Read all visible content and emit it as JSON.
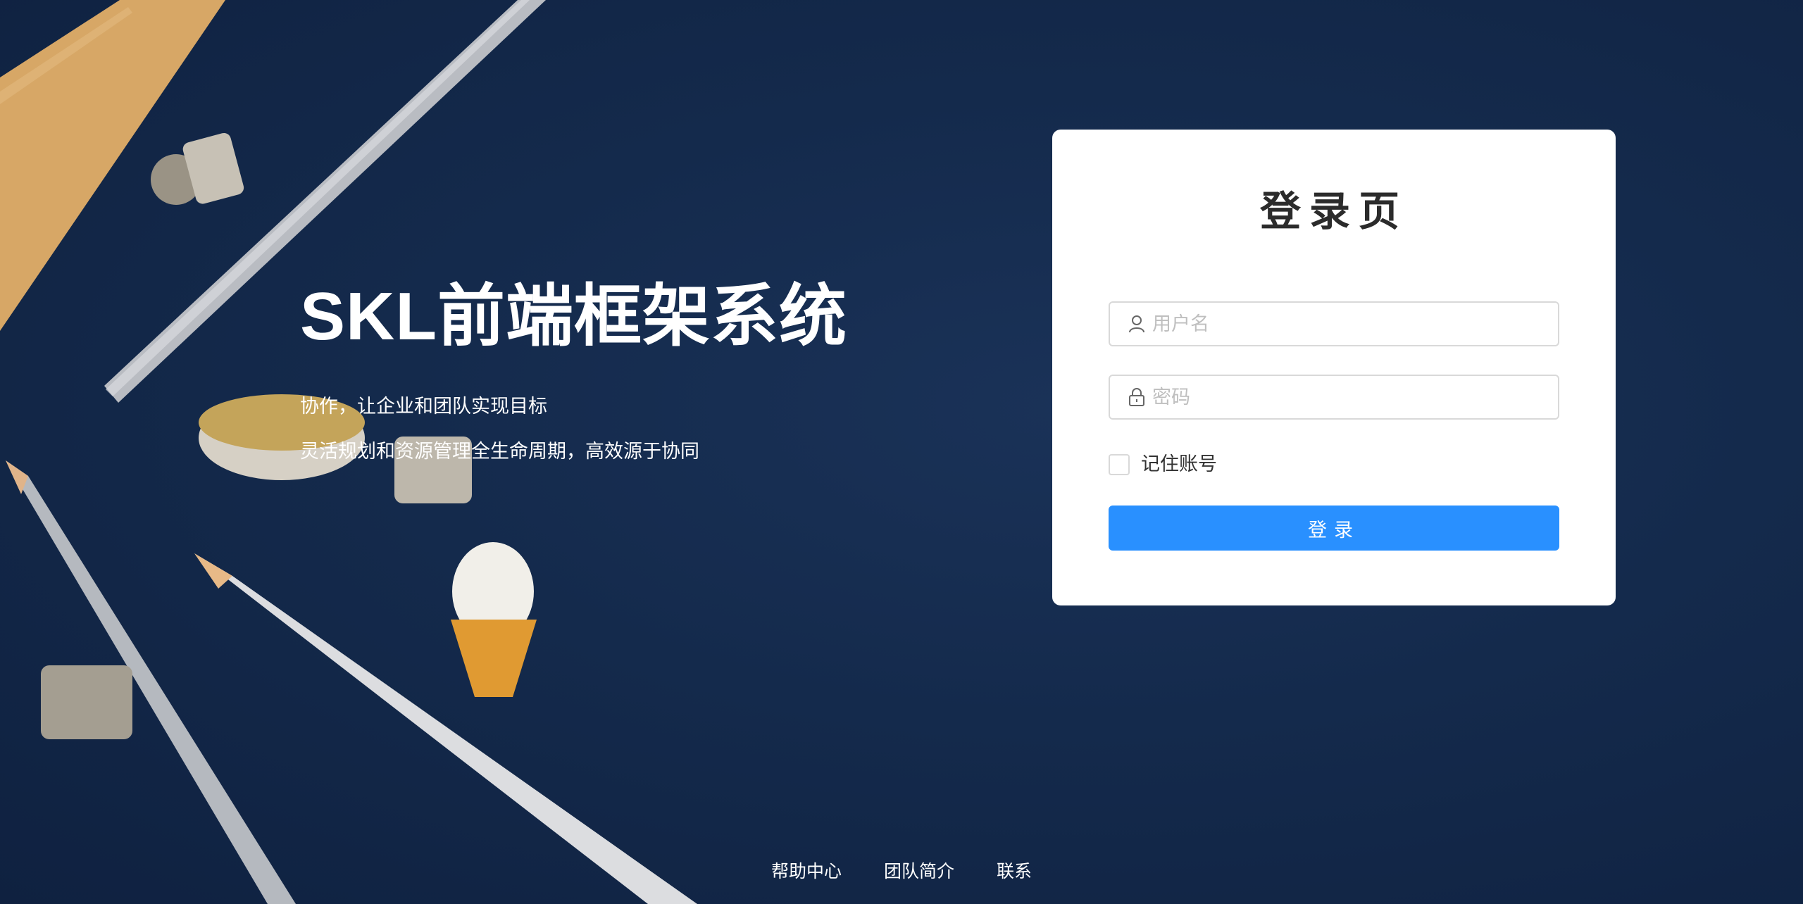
{
  "hero": {
    "title": "SKL前端框架系统",
    "line1": "协作，让企业和团队实现目标",
    "line2": "灵活规划和资源管理全生命周期，高效源于协同"
  },
  "login": {
    "title": "登录页",
    "username_placeholder": "用户名",
    "password_placeholder": "密码",
    "remember_label": "记住账号",
    "remember_checked": false,
    "submit_label": "登录"
  },
  "footer": {
    "links": [
      "帮助中心",
      "团队简介",
      "联系"
    ]
  },
  "colors": {
    "background": "#142a4c",
    "primary": "#2990ff",
    "card": "#ffffff"
  },
  "icons": {
    "username": "user-icon",
    "password": "lock-icon"
  }
}
